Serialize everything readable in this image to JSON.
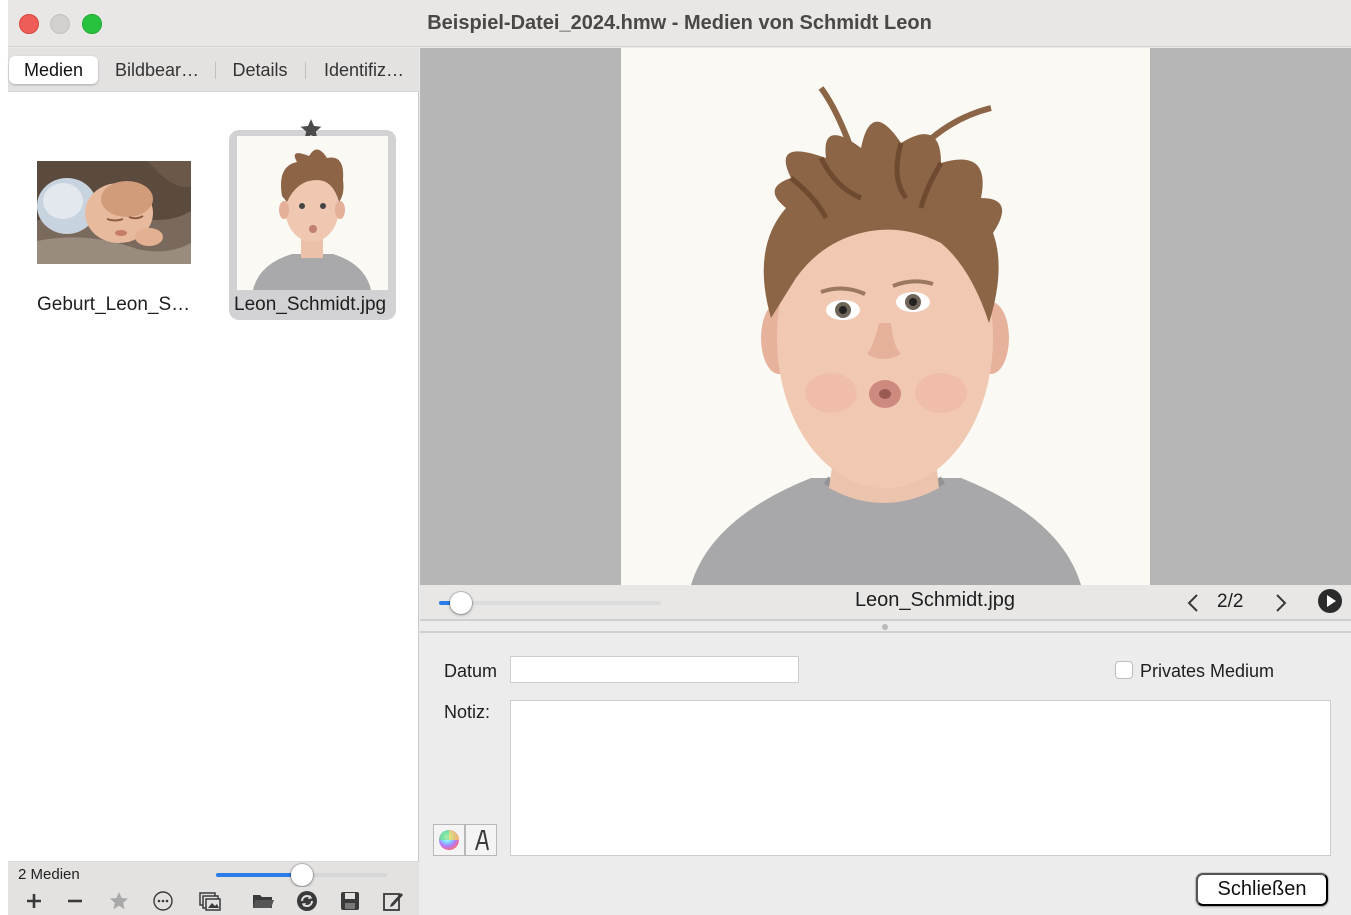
{
  "window": {
    "title": "Beispiel-Datei_2024.hmw - Medien von Schmidt Leon"
  },
  "tabs": [
    {
      "label": "Medien",
      "active": true
    },
    {
      "label": "Bildbear…",
      "active": false
    },
    {
      "label": "Details",
      "active": false
    },
    {
      "label": "Identifiz…",
      "active": false
    }
  ],
  "media": [
    {
      "label": "Geburt_Leon_S…",
      "selected": false,
      "favorite": false
    },
    {
      "label": "Leon_Schmidt.jpg",
      "selected": true,
      "favorite": true
    }
  ],
  "statusbar": {
    "count_label": "2 Medien",
    "thumb_size_fraction": 0.5
  },
  "toolbar": {
    "icons": [
      "plus-icon",
      "minus-icon",
      "star-icon",
      "more-icon",
      "gallery-icon",
      "folder-icon",
      "refresh-icon",
      "save-icon",
      "edit-icon"
    ]
  },
  "viewer": {
    "filename": "Leon_Schmidt.jpg",
    "position": "2/2",
    "zoom_fraction": 0.1
  },
  "form": {
    "date_label": "Datum",
    "date_value": "",
    "private_label": "Privates Medium",
    "private_checked": false,
    "note_label": "Notiz:",
    "note_value": "",
    "close_label": "Schließen"
  },
  "colors": {
    "accent": "#2b7de9",
    "close": "#ee5d57",
    "maximize": "#29c23f"
  }
}
